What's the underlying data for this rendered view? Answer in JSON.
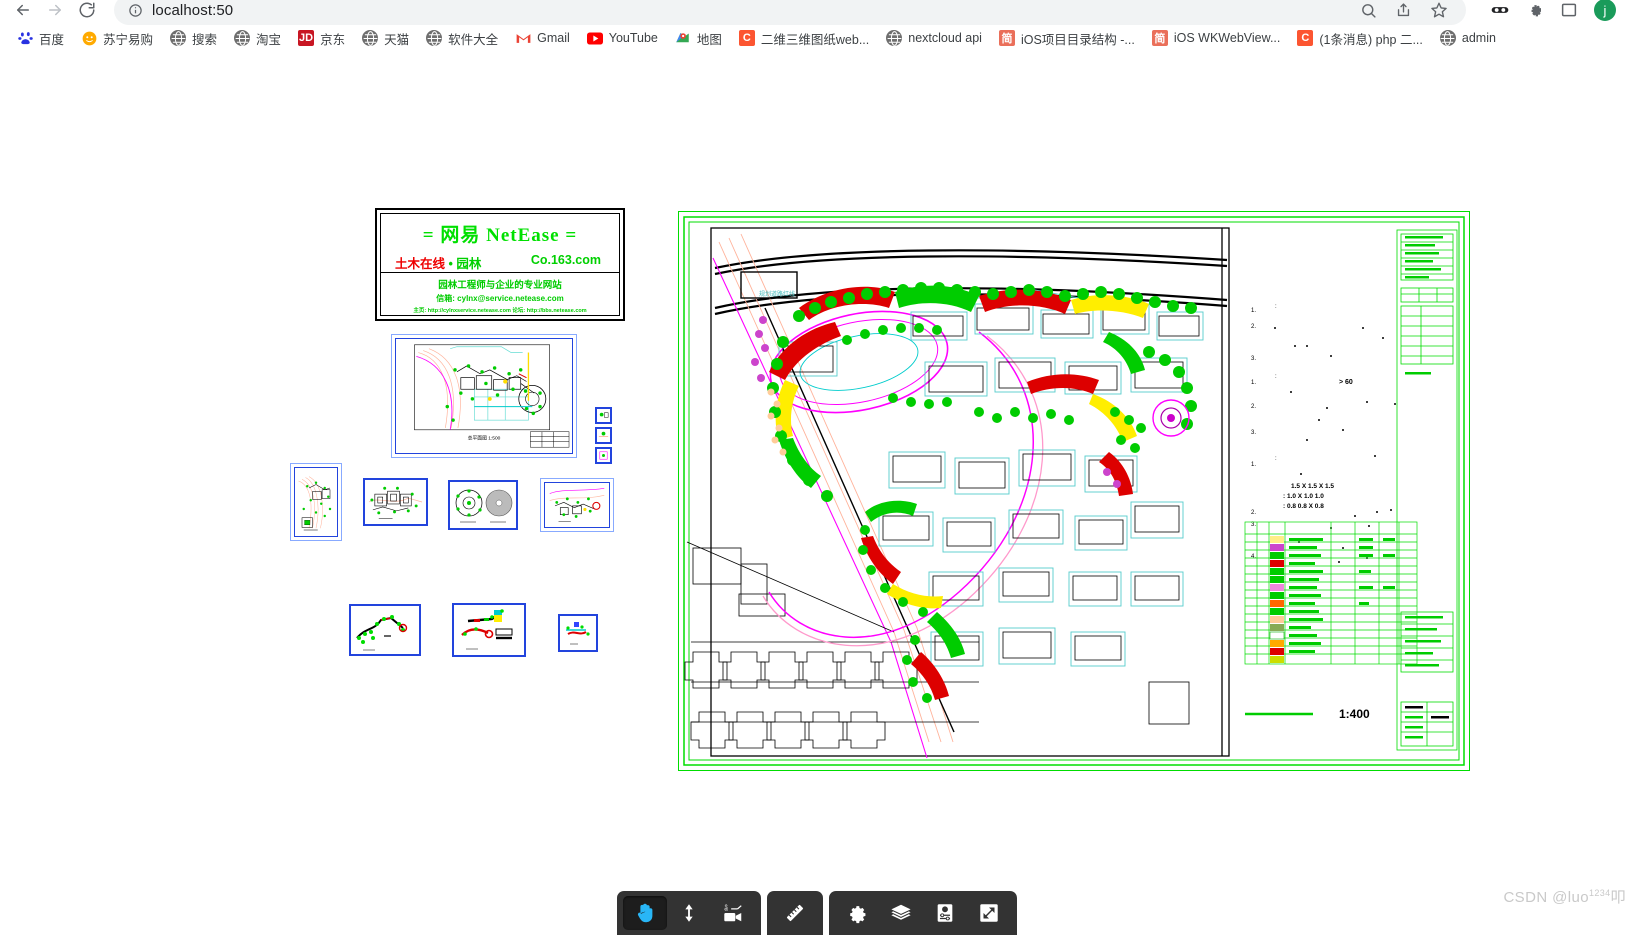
{
  "browser": {
    "back_icon": "back-arrow-icon",
    "forward_icon": "forward-arrow-icon",
    "reload_icon": "reload-icon",
    "url": "localhost:50",
    "site_info_icon": "info-circle-icon",
    "search_icon": "search-icon",
    "share_icon": "share-icon",
    "bookmark_icon": "star-icon",
    "extension_icon": "puzzle-icon",
    "sidepanel_icon": "side-panel-icon",
    "avatar_letter": "j"
  },
  "bookmarks": [
    {
      "label": "百度",
      "icon": "baidu-icon",
      "type": "baidu",
      "color": "#2932e1"
    },
    {
      "label": "苏宁易购",
      "icon": "suning-icon",
      "type": "suning",
      "color": "#ffaa00"
    },
    {
      "label": "搜索",
      "icon": "globe-icon",
      "type": "globe",
      "color": "#6e6e6e"
    },
    {
      "label": "淘宝",
      "icon": "globe-icon",
      "type": "globe",
      "color": "#6e6e6e"
    },
    {
      "label": "京东",
      "icon": "jd-icon",
      "type": "square",
      "color": "#c81623",
      "glyph": "JD"
    },
    {
      "label": "天猫",
      "icon": "globe-icon",
      "type": "globe",
      "color": "#6e6e6e"
    },
    {
      "label": "软件大全",
      "icon": "globe-icon",
      "type": "globe",
      "color": "#6e6e6e"
    },
    {
      "label": "Gmail",
      "icon": "gmail-icon",
      "type": "gmail",
      "color": "#ea4335"
    },
    {
      "label": "YouTube",
      "icon": "youtube-icon",
      "type": "youtube",
      "color": "#ff0000"
    },
    {
      "label": "地图",
      "icon": "maps-pin-icon",
      "type": "maps",
      "color": "#34a853"
    },
    {
      "label": "二维三维图纸web...",
      "icon": "csdn-icon",
      "type": "square",
      "color": "#fc5531",
      "glyph": "C"
    },
    {
      "label": "nextcloud api",
      "icon": "globe-icon",
      "type": "globe",
      "color": "#6e6e6e"
    },
    {
      "label": "iOS项目目录结构 -...",
      "icon": "jianshu-icon",
      "type": "square",
      "color": "#ea6f5a",
      "glyph": "简"
    },
    {
      "label": "iOS WKWebView...",
      "icon": "jianshu-icon",
      "type": "square",
      "color": "#ea6f5a",
      "glyph": "简"
    },
    {
      "label": "(1条消息) php 二...",
      "icon": "csdn-icon",
      "type": "square",
      "color": "#fc5531",
      "glyph": "C"
    },
    {
      "label": "admin",
      "icon": "globe-icon",
      "type": "globe",
      "color": "#6e6e6e"
    }
  ],
  "drawing": {
    "title_block": {
      "title": "=  网易  NetEase  =",
      "left_red": "土木在线",
      "left_green": "• 园林",
      "right_green": "Co.163.com",
      "line1": "园林工程师与企业的专业网站",
      "line2": "信箱: cylnx@service.netease.com",
      "line3": "主页: http://cylnxservice.netease.com    论坛: http://bbs.netease.com"
    },
    "scale_label": "1:400",
    "plan_label": "总平面图 1:500",
    "colors": {
      "sheet_border": "#00dd00",
      "frame_blue": "#2244dd",
      "accent_green": "#00e000",
      "accent_red": "#ee0000",
      "road_pink": "#ff99cc",
      "path_magenta": "#ff00ff",
      "water_cyan": "#00cccc",
      "tree_green": "#00cc00",
      "highlight_yellow": "#ffff00"
    }
  },
  "toolbar": {
    "groups": [
      {
        "name": "navigation-group",
        "buttons": [
          {
            "name": "pan-tool-button",
            "icon": "hand-icon",
            "label": "Pan",
            "active": true
          },
          {
            "name": "orbit-tool-button",
            "icon": "up-down-arrow-icon",
            "label": "Vertical Move",
            "active": false
          },
          {
            "name": "camera-tool-button",
            "icon": "camera-text-icon",
            "label": "Camera",
            "active": false
          }
        ]
      },
      {
        "name": "measure-group",
        "buttons": [
          {
            "name": "measure-tool-button",
            "icon": "ruler-icon",
            "label": "Measure",
            "active": false
          }
        ]
      },
      {
        "name": "settings-group",
        "buttons": [
          {
            "name": "settings-button",
            "icon": "gear-icon",
            "label": "Settings",
            "active": false
          },
          {
            "name": "layers-button",
            "icon": "layers-icon",
            "label": "Layers",
            "active": false
          },
          {
            "name": "properties-button",
            "icon": "properties-icon",
            "label": "Properties",
            "active": false
          },
          {
            "name": "fullscreen-button",
            "icon": "fullscreen-icon",
            "label": "Full Screen",
            "active": false
          }
        ]
      }
    ]
  },
  "watermark": {
    "prefix": "CSDN @luo",
    "sup": "1234",
    "suffix": "叩"
  }
}
